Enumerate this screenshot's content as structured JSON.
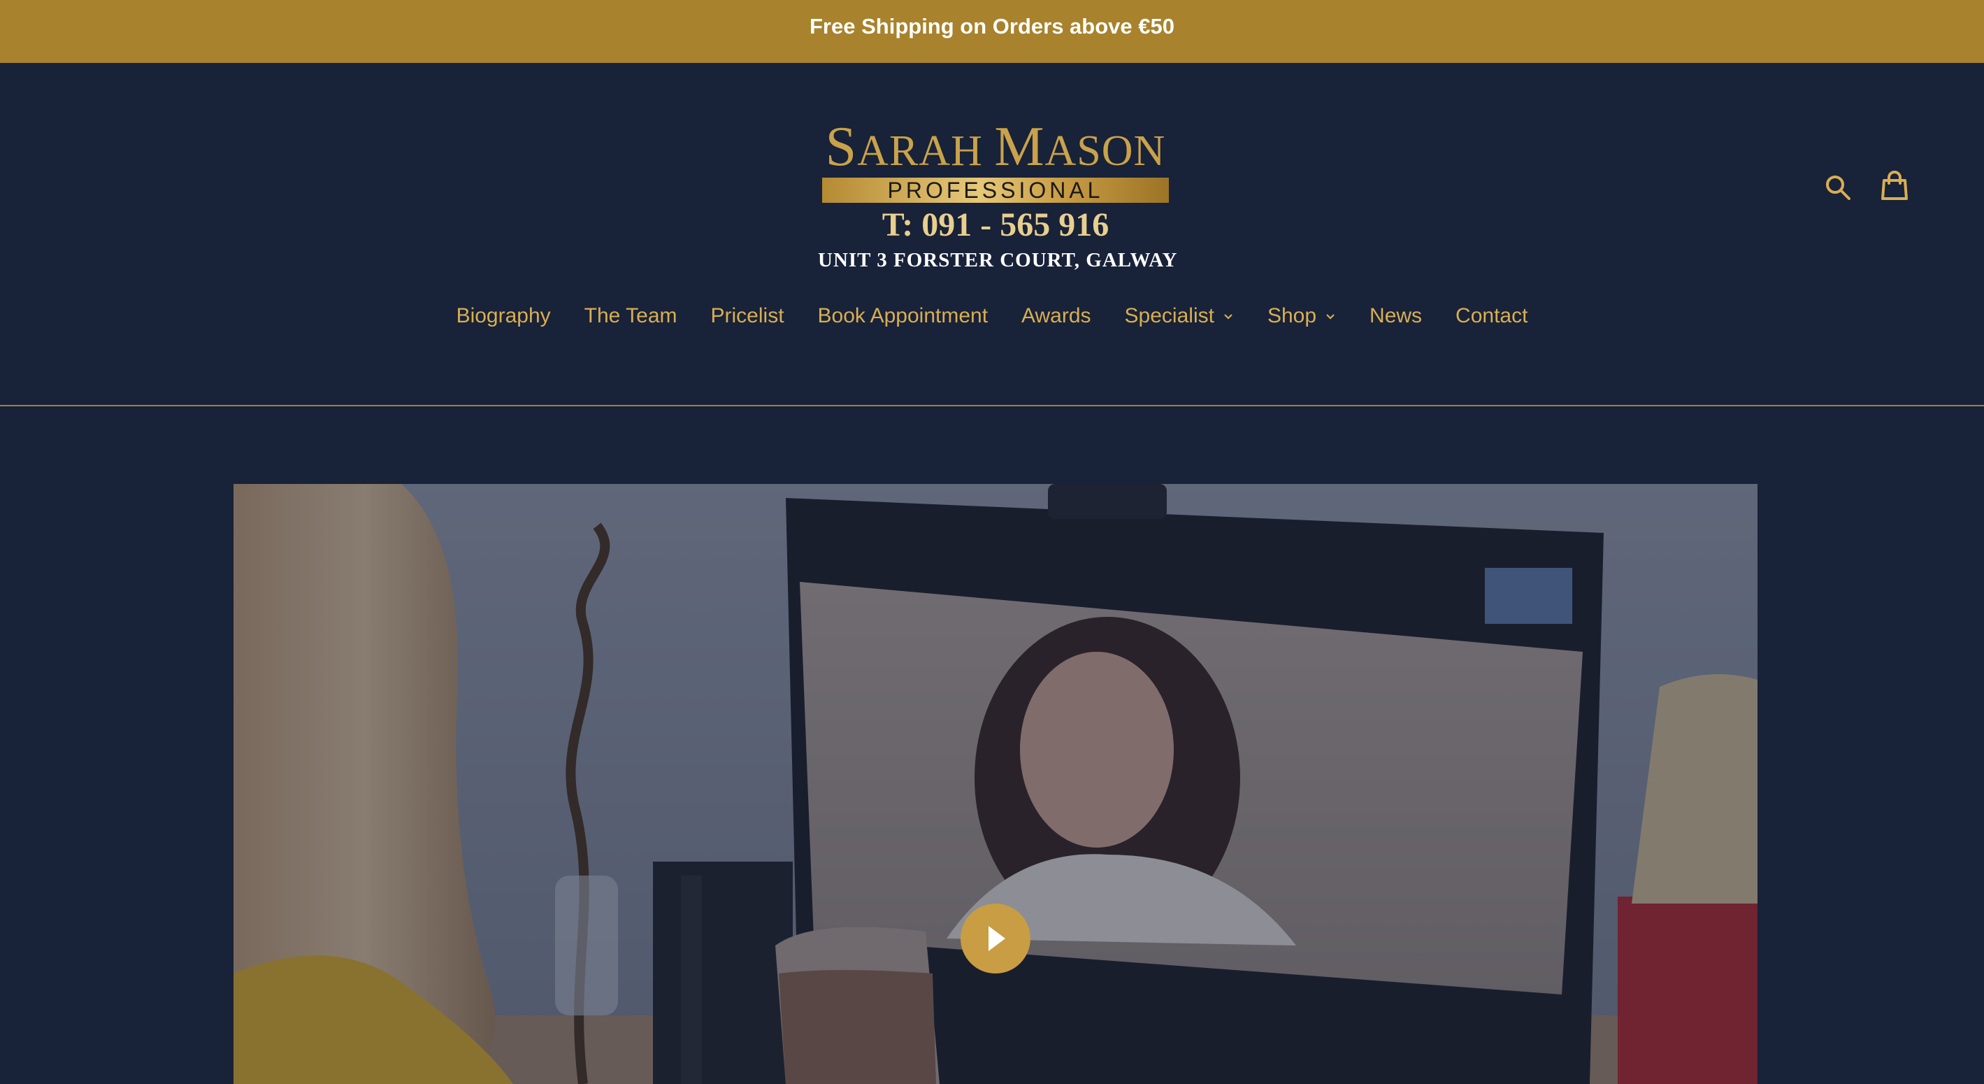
{
  "announcement": {
    "text": "Free Shipping on Orders above €50"
  },
  "logo": {
    "name_first_initial": "S",
    "name_first_rest": "ARAH",
    "name_last_initial": "M",
    "name_last_rest": "ASON",
    "tagline": "PROFESSIONAL",
    "phone": "T: 091 - 565 916",
    "address": "UNIT 3 FORSTER COURT, GALWAY"
  },
  "header_icons": {
    "search": "search-icon",
    "cart": "cart-icon"
  },
  "nav": {
    "items": [
      {
        "label": "Biography"
      },
      {
        "label": "The Team"
      },
      {
        "label": "Pricelist"
      },
      {
        "label": "Book Appointment"
      },
      {
        "label": "Awards"
      },
      {
        "label": "Specialist",
        "has_dropdown": true
      },
      {
        "label": "Shop",
        "has_dropdown": true
      },
      {
        "label": "News"
      },
      {
        "label": "Contact"
      }
    ]
  },
  "hero": {
    "play_icon": "play-icon"
  },
  "colors": {
    "background": "#182238",
    "accent_gold": "#a8822c",
    "nav_text": "#d9ae52",
    "play_button": "#c89d43"
  }
}
